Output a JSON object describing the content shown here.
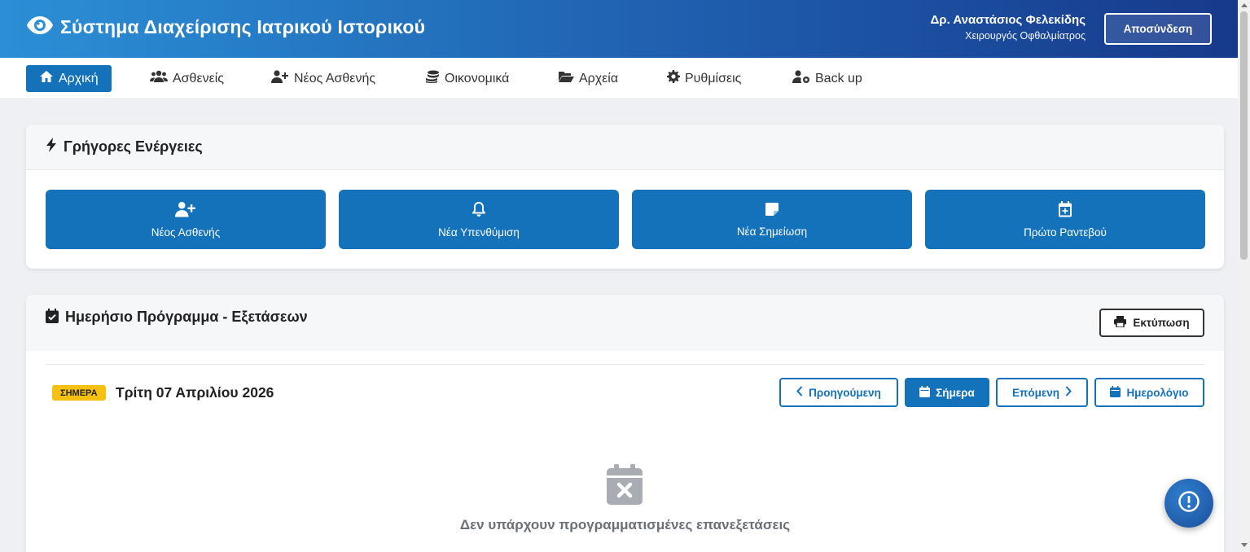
{
  "header": {
    "title": "Σύστημα Διαχείρισης Ιατρικού Ιστορικού",
    "user_name": "Δρ. Αναστάσιος Φελεκίδης",
    "user_role": "Χειρουργός Οφθαλμίατρος",
    "logout_label": "Αποσύνδεση"
  },
  "nav": {
    "items": [
      {
        "label": "Αρχική",
        "icon": "home-icon",
        "active": true
      },
      {
        "label": "Ασθενείς",
        "icon": "users-icon"
      },
      {
        "label": "Νέος Ασθενής",
        "icon": "user-plus-icon"
      },
      {
        "label": "Οικονομικά",
        "icon": "coins-icon"
      },
      {
        "label": "Αρχεία",
        "icon": "folder-open-icon"
      },
      {
        "label": "Ρυθμίσεις",
        "icon": "gear-icon"
      },
      {
        "label": "Back up",
        "icon": "user-cog-icon"
      }
    ]
  },
  "quick_actions": {
    "title": "Γρήγορες Ενέργειες",
    "buttons": [
      {
        "label": "Νέος Ασθενής",
        "icon": "user-plus-icon"
      },
      {
        "label": "Νέα Υπενθύμιση",
        "icon": "bell-icon"
      },
      {
        "label": "Νέα Σημείωση",
        "icon": "sticky-note-icon"
      },
      {
        "label": "Πρώτο Ραντεβού",
        "icon": "calendar-plus-icon"
      }
    ]
  },
  "schedule": {
    "title": "Ημερήσιο Πρόγραμμα - Εξετάσεων",
    "print_label": "Εκτύπωση",
    "today_badge": "ΣΗΜΕΡΑ",
    "date": "Τρίτη 07 Απριλίου 2026",
    "prev_label": "Προηγούμενη",
    "today_label": "Σήμερα",
    "next_label": "Επόμενη",
    "calendar_label": "Ημερολόγιο",
    "empty_message": "Δεν υπάρχουν προγραμματισμένες επανεξετάσεις"
  },
  "colors": {
    "primary": "#1372b9",
    "badge": "#f5c012",
    "header_start": "#2b8fd6",
    "header_end": "#17398c"
  }
}
